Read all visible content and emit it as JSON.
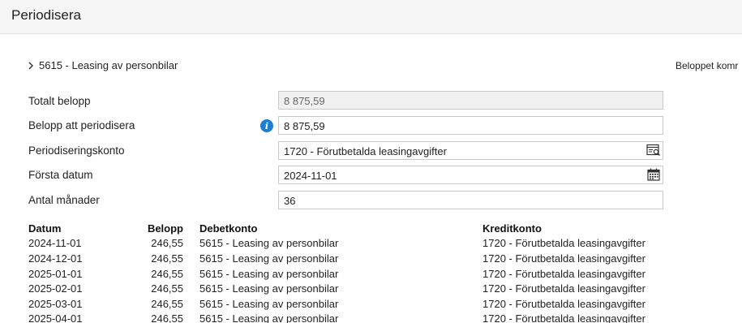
{
  "header": {
    "title": "Periodisera"
  },
  "section": {
    "label": "5615 - Leasing av personbilar"
  },
  "right_note": "Beloppet komr",
  "form": {
    "total_label": "Totalt belopp",
    "total_value": "8 875,59",
    "amount_label": "Belopp att periodisera",
    "amount_value": "8 875,59",
    "account_label": "Periodiseringskonto",
    "account_value": "1720 - Förutbetalda leasingavgifter",
    "first_date_label": "Första datum",
    "first_date_value": "2024-11-01",
    "months_label": "Antal månader",
    "months_value": "36"
  },
  "table": {
    "headers": {
      "date": "Datum",
      "amount": "Belopp",
      "debit": "Debetkonto",
      "credit": "Kreditkonto"
    },
    "rows": [
      {
        "date": "2024-11-01",
        "amount": "246,55",
        "debit": "5615 - Leasing av personbilar",
        "credit": "1720 - Förutbetalda leasingavgifter"
      },
      {
        "date": "2024-12-01",
        "amount": "246,55",
        "debit": "5615 - Leasing av personbilar",
        "credit": "1720 - Förutbetalda leasingavgifter"
      },
      {
        "date": "2025-01-01",
        "amount": "246,55",
        "debit": "5615 - Leasing av personbilar",
        "credit": "1720 - Förutbetalda leasingavgifter"
      },
      {
        "date": "2025-02-01",
        "amount": "246,55",
        "debit": "5615 - Leasing av personbilar",
        "credit": "1720 - Förutbetalda leasingavgifter"
      },
      {
        "date": "2025-03-01",
        "amount": "246,55",
        "debit": "5615 - Leasing av personbilar",
        "credit": "1720 - Förutbetalda leasingavgifter"
      },
      {
        "date": "2025-04-01",
        "amount": "246,55",
        "debit": "5615 - Leasing av personbilar",
        "credit": "1720 - Förutbetalda leasingavgifter"
      }
    ]
  },
  "colors": {
    "info": "#1a7fd4",
    "header_bg": "#f5f5f5",
    "readonly_bg": "#f0f0f0",
    "border": "#c9c9c9"
  },
  "icons": {
    "info": "info-icon",
    "lookup": "search-list-icon",
    "calendar": "calendar-icon",
    "expand": "chevron-right-icon"
  }
}
